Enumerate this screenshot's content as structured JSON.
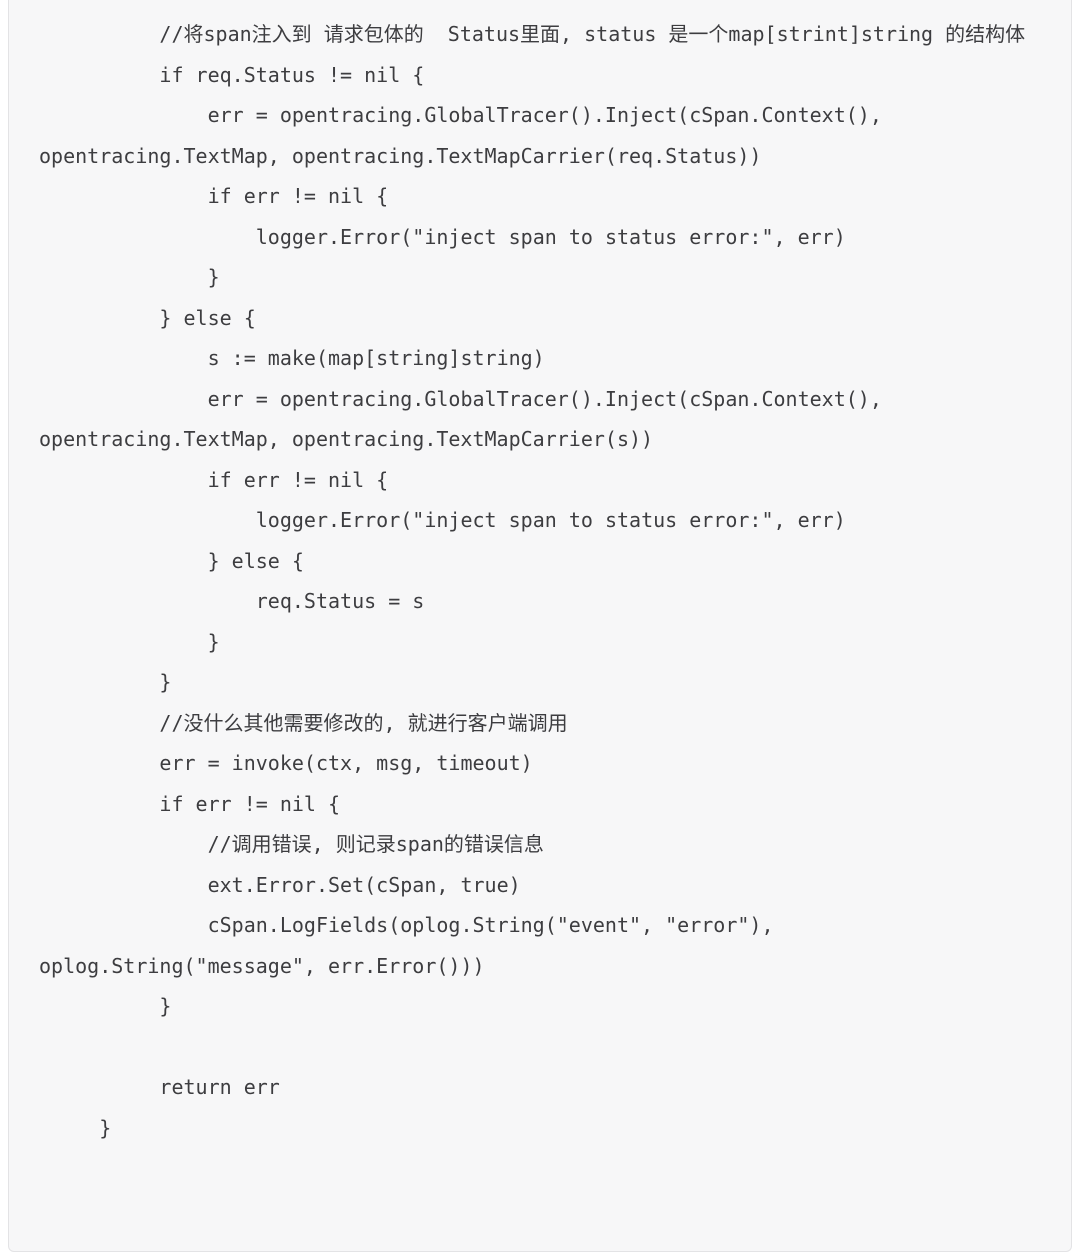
{
  "code_block": {
    "language": "go",
    "background_color": "#f7f7f8",
    "text_color": "#3d3d40",
    "border_color": "#e3e3e5",
    "page_background": "#ffffff",
    "font_size_px": 20,
    "line_height_px": 40.5,
    "lines": [
      "          //将span注入到 请求包体的  Status里面, status 是一个map[strint]string 的结构体",
      "          if req.Status != nil {",
      "              err = opentracing.GlobalTracer().Inject(cSpan.Context(), opentracing.TextMap, opentracing.TextMapCarrier(req.Status))",
      "              if err != nil {",
      "                  logger.Error(\"inject span to status error:\", err)",
      "              }",
      "          } else {",
      "              s := make(map[string]string)",
      "              err = opentracing.GlobalTracer().Inject(cSpan.Context(), opentracing.TextMap, opentracing.TextMapCarrier(s))",
      "              if err != nil {",
      "                  logger.Error(\"inject span to status error:\", err)",
      "              } else {",
      "                  req.Status = s",
      "              }",
      "          }",
      "          //没什么其他需要修改的, 就进行客户端调用",
      "          err = invoke(ctx, msg, timeout)",
      "          if err != nil {",
      "              //调用错误, 则记录span的错误信息",
      "              ext.Error.Set(cSpan, true)",
      "              cSpan.LogFields(oplog.String(\"event\", \"error\"), oplog.String(\"message\", err.Error()))",
      "          }",
      "",
      "          return err",
      "     }"
    ]
  }
}
